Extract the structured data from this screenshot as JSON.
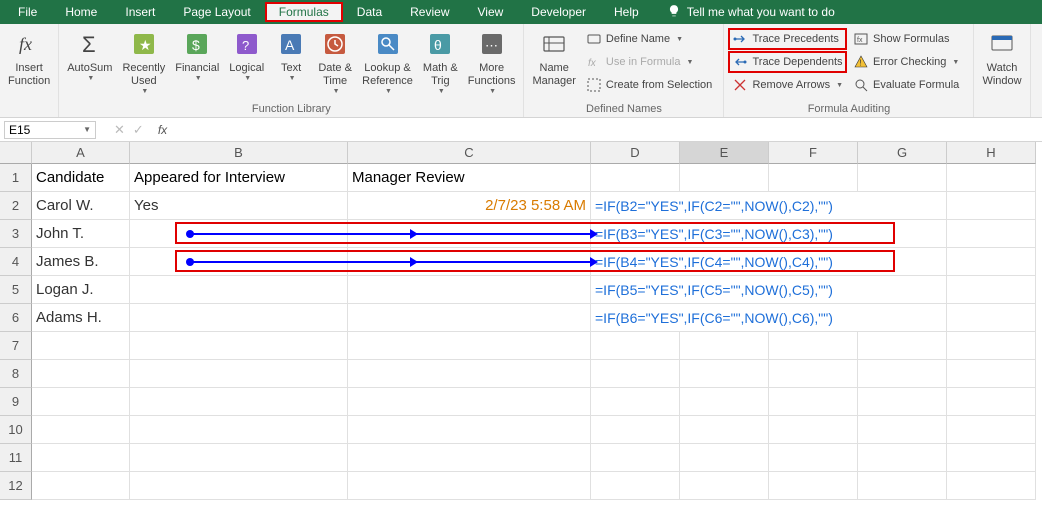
{
  "menubar": {
    "tabs": [
      "File",
      "Home",
      "Insert",
      "Page Layout",
      "Formulas",
      "Data",
      "Review",
      "View",
      "Developer",
      "Help"
    ],
    "active_index": 4,
    "tell_me": "Tell me what you want to do"
  },
  "ribbon": {
    "insert_function": "Insert\nFunction",
    "function_library": {
      "label": "Function Library",
      "buttons": [
        "AutoSum",
        "Recently\nUsed",
        "Financial",
        "Logical",
        "Text",
        "Date &\nTime",
        "Lookup &\nReference",
        "Math &\nTrig",
        "More\nFunctions"
      ]
    },
    "defined_names": {
      "label": "Defined Names",
      "name_manager": "Name\nManager",
      "define_name": "Define Name",
      "use_in_formula": "Use in Formula",
      "create_from_selection": "Create from Selection"
    },
    "formula_auditing": {
      "label": "Formula Auditing",
      "trace_precedents": "Trace Precedents",
      "trace_dependents": "Trace Dependents",
      "remove_arrows": "Remove Arrows",
      "show_formulas": "Show Formulas",
      "error_checking": "Error Checking",
      "evaluate_formula": "Evaluate Formula"
    },
    "watch_window": "Watch\nWindow"
  },
  "name_box": "E15",
  "formula_bar_value": "",
  "columns": [
    "A",
    "B",
    "C",
    "D",
    "E",
    "F",
    "G",
    "H"
  ],
  "rows": [
    "1",
    "2",
    "3",
    "4",
    "5",
    "6",
    "7",
    "8",
    "9",
    "10",
    "11",
    "12"
  ],
  "cells": {
    "A1": "Candidate",
    "B1": "Appeared for Interview",
    "C1": "Manager Review",
    "A2": "Carol W.",
    "B2": "Yes",
    "C2": "2/7/23 5:58 AM",
    "D2": "=IF(B2=\"YES\",IF(C2=\"\",NOW(),C2),\"\")",
    "A3": "John T.",
    "D3": "=IF(B3=\"YES\",IF(C3=\"\",NOW(),C3),\"\")",
    "A4": "James B.",
    "D4": "=IF(B4=\"YES\",IF(C4=\"\",NOW(),C4),\"\")",
    "A5": "Logan J.",
    "D5": "=IF(B5=\"YES\",IF(C5=\"\",NOW(),C5),\"\")",
    "A6": "Adams H.",
    "D6": "=IF(B6=\"YES\",IF(C6=\"\",NOW(),C6),\"\")"
  }
}
